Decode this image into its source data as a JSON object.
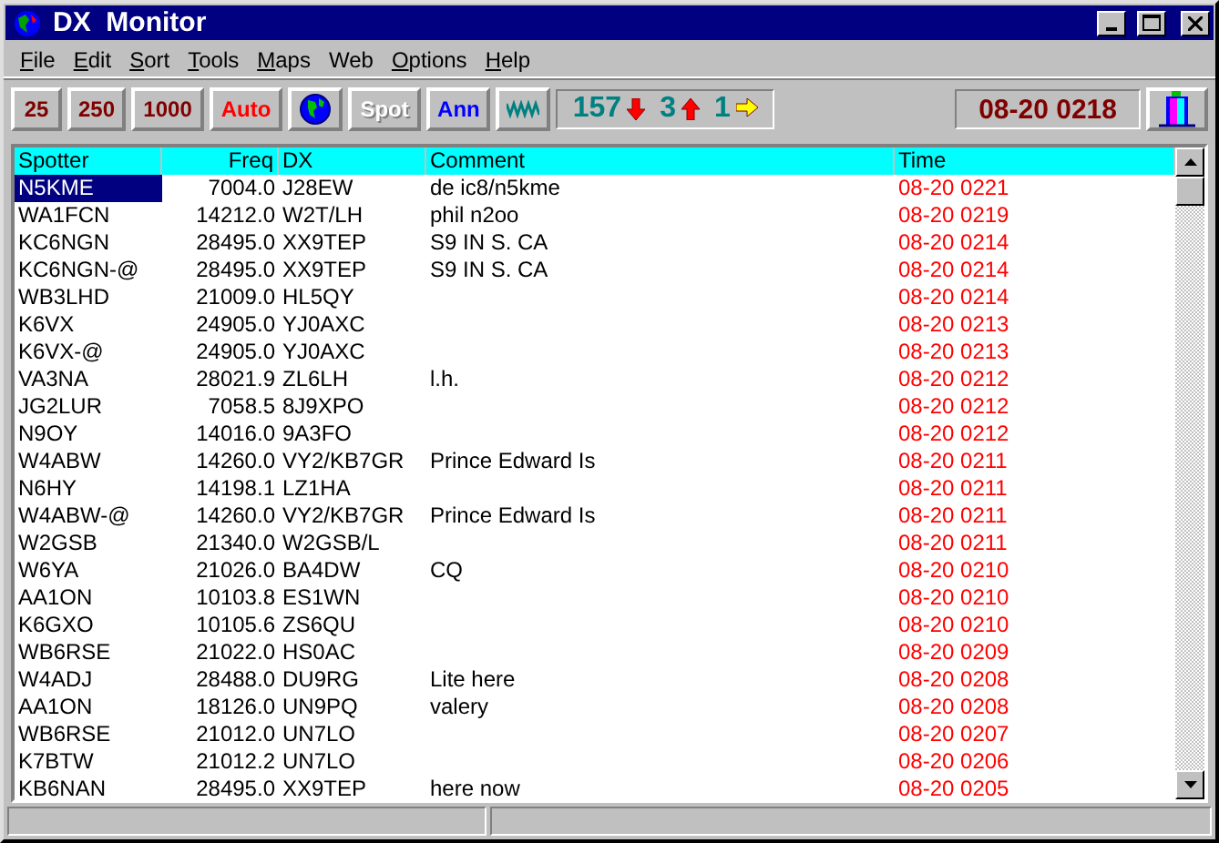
{
  "window": {
    "title": "DX  Monitor"
  },
  "menu": [
    {
      "label": "File",
      "underlined": true
    },
    {
      "label": "Edit",
      "underlined": true
    },
    {
      "label": "Sort",
      "underlined": true
    },
    {
      "label": "Tools",
      "underlined": true
    },
    {
      "label": "Maps",
      "underlined": true
    },
    {
      "label": "Web",
      "underlined": false
    },
    {
      "label": "Options",
      "underlined": true
    },
    {
      "label": "Help",
      "underlined": true
    }
  ],
  "toolbar": [
    {
      "kind": "text",
      "label": "25",
      "color": "#800000"
    },
    {
      "kind": "text",
      "label": "250",
      "color": "#800000"
    },
    {
      "kind": "text",
      "label": "1000",
      "color": "#800000"
    },
    {
      "kind": "text",
      "label": "Auto",
      "color": "#ff0000"
    },
    {
      "kind": "globe"
    },
    {
      "kind": "text",
      "label": "Spot",
      "color": "#ffffff"
    },
    {
      "kind": "text",
      "label": "Ann",
      "color": "#0000ff"
    },
    {
      "kind": "wave"
    }
  ],
  "counters": [
    {
      "value": "157",
      "kind": "down"
    },
    {
      "value": "3",
      "kind": "up"
    },
    {
      "value": "1",
      "kind": "right"
    }
  ],
  "clock": "08-20 0218",
  "table": {
    "columns": [
      "Spotter",
      "Freq",
      "DX",
      "Comment",
      "Time"
    ],
    "rows": [
      {
        "cells": [
          "N5KME",
          "7004.0",
          "J28EW",
          "de ic8/n5kme",
          "08-20 0221"
        ],
        "selected": true
      },
      {
        "cells": [
          "WA1FCN",
          "14212.0",
          "W2T/LH",
          "phil n2oo",
          "08-20 0219"
        ],
        "selected": false
      },
      {
        "cells": [
          "KC6NGN",
          "28495.0",
          "XX9TEP",
          "S9 IN S. CA",
          "08-20 0214"
        ],
        "selected": false
      },
      {
        "cells": [
          "KC6NGN-@",
          "28495.0",
          "XX9TEP",
          "S9 IN S. CA",
          "08-20 0214"
        ],
        "selected": false
      },
      {
        "cells": [
          "WB3LHD",
          "21009.0",
          "HL5QY",
          "",
          "08-20 0214"
        ],
        "selected": false
      },
      {
        "cells": [
          "K6VX",
          "24905.0",
          "YJ0AXC",
          "",
          "08-20 0213"
        ],
        "selected": false
      },
      {
        "cells": [
          "K6VX-@",
          "24905.0",
          "YJ0AXC",
          "",
          "08-20 0213"
        ],
        "selected": false
      },
      {
        "cells": [
          "VA3NA",
          "28021.9",
          "ZL6LH",
          "l.h.",
          "08-20 0212"
        ],
        "selected": false
      },
      {
        "cells": [
          "JG2LUR",
          "7058.5",
          "8J9XPO",
          "",
          "08-20 0212"
        ],
        "selected": false
      },
      {
        "cells": [
          "N9OY",
          "14016.0",
          "9A3FO",
          "",
          "08-20 0212"
        ],
        "selected": false
      },
      {
        "cells": [
          "W4ABW",
          "14260.0",
          "VY2/KB7GR",
          "Prince Edward Is",
          "08-20 0211"
        ],
        "selected": false
      },
      {
        "cells": [
          "N6HY",
          "14198.1",
          "LZ1HA",
          "",
          "08-20 0211"
        ],
        "selected": false
      },
      {
        "cells": [
          "W4ABW-@",
          "14260.0",
          "VY2/KB7GR",
          "Prince Edward Is",
          "08-20 0211"
        ],
        "selected": false
      },
      {
        "cells": [
          "W2GSB",
          "21340.0",
          "W2GSB/L",
          "",
          "08-20 0211"
        ],
        "selected": false
      },
      {
        "cells": [
          "W6YA",
          "21026.0",
          "BA4DW",
          "CQ",
          "08-20 0210"
        ],
        "selected": false
      },
      {
        "cells": [
          "AA1ON",
          "10103.8",
          "ES1WN",
          "",
          "08-20 0210"
        ],
        "selected": false
      },
      {
        "cells": [
          "K6GXO",
          "10105.6",
          "ZS6QU",
          "",
          "08-20 0210"
        ],
        "selected": false
      },
      {
        "cells": [
          "WB6RSE",
          "21022.0",
          "HS0AC",
          "",
          "08-20 0209"
        ],
        "selected": false
      },
      {
        "cells": [
          "W4ADJ",
          "28488.0",
          "DU9RG",
          "Lite here",
          "08-20 0208"
        ],
        "selected": false
      },
      {
        "cells": [
          "AA1ON",
          "18126.0",
          "UN9PQ",
          "valery",
          "08-20 0208"
        ],
        "selected": false
      },
      {
        "cells": [
          "WB6RSE",
          "21012.0",
          "UN7LO",
          "",
          "08-20 0207"
        ],
        "selected": false
      },
      {
        "cells": [
          "K7BTW",
          "21012.2",
          "UN7LO",
          "",
          "08-20 0206"
        ],
        "selected": false
      },
      {
        "cells": [
          "KB6NAN",
          "28495.0",
          "XX9TEP",
          "here now",
          "08-20 0205"
        ],
        "selected": false
      }
    ]
  }
}
